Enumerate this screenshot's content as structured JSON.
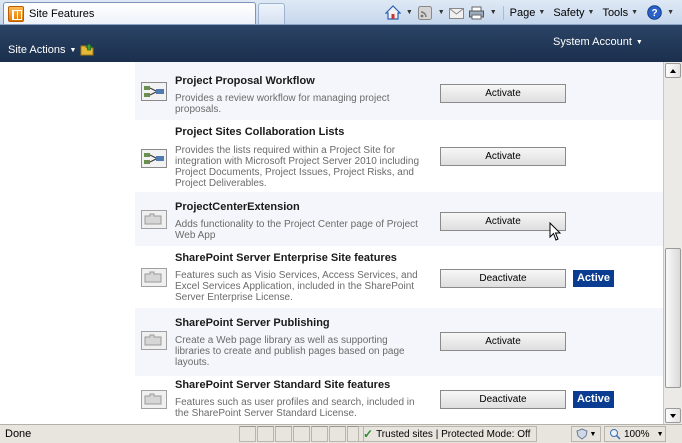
{
  "browser": {
    "tab_title": "Site Features",
    "commands": {
      "page": "Page",
      "safety": "Safety",
      "tools": "Tools"
    },
    "icons": [
      "home-icon",
      "rss-icon",
      "mail-icon",
      "print-icon",
      "help-icon"
    ]
  },
  "ribbon": {
    "site_actions": "Site Actions",
    "user": "System Account",
    "colors": {
      "background": "#1b2f4d"
    }
  },
  "features": [
    {
      "title": "Project Proposal Workflow",
      "description": "Provides a review workflow for managing project proposals.",
      "button": "Activate",
      "badge": "",
      "icon": "workflow-icon"
    },
    {
      "title": "Project Sites Collaboration Lists",
      "description": "Provides the lists required within a Project Site for integration with Microsoft Project Server 2010 including Project Documents, Project Issues, Project Risks, and Project Deliverables.",
      "button": "Activate",
      "badge": "",
      "icon": "workflow-icon"
    },
    {
      "title": "ProjectCenterExtension",
      "description": "Adds functionality to the Project Center page of Project Web App",
      "button": "Activate",
      "badge": "",
      "icon": "feature-icon"
    },
    {
      "title": "SharePoint Server Enterprise Site features",
      "description": "Features such as Visio Services, Access Services, and Excel Services Application, included in the SharePoint Server Enterprise License.",
      "button": "Deactivate",
      "badge": "Active",
      "icon": "feature-icon"
    },
    {
      "title": "SharePoint Server Publishing",
      "description": "Create a Web page library as well as supporting libraries to create and publish pages based on page layouts.",
      "button": "Activate",
      "badge": "",
      "icon": "feature-icon"
    },
    {
      "title": "SharePoint Server Standard Site features",
      "description": "Features such as user profiles and search, included in the SharePoint Server Standard License.",
      "button": "Deactivate",
      "badge": "Active",
      "icon": "feature-icon"
    }
  ],
  "status_bar": {
    "status": "Done",
    "zone": "Trusted sites | Protected Mode: Off",
    "zoom": "100%"
  }
}
